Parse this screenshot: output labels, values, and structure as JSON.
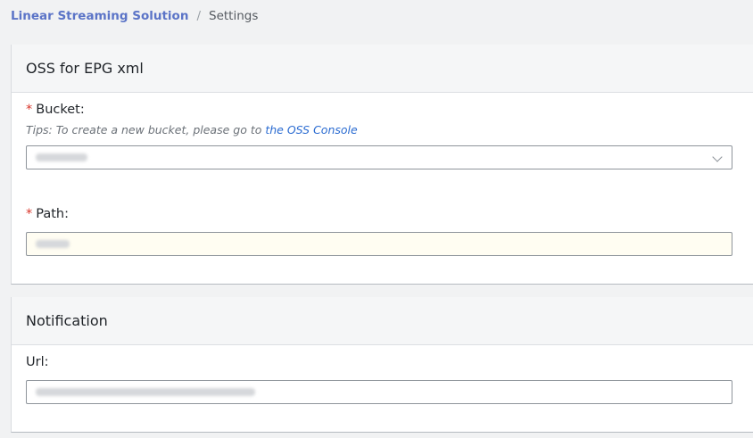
{
  "breadcrumb": {
    "root": "Linear Streaming Solution",
    "separator": "/",
    "current": "Settings"
  },
  "oss_section": {
    "title": "OSS for EPG xml",
    "bucket": {
      "required_mark": "*",
      "label": "Bucket:",
      "tips_prefix": "Tips: To create a new bucket, please go to",
      "tips_link": "the OSS Console",
      "value": "",
      "icon": "chevron-down-icon"
    },
    "path": {
      "required_mark": "*",
      "label": "Path:",
      "value": ""
    }
  },
  "notification_section": {
    "title": "Notification",
    "url": {
      "label": "Url:",
      "value": ""
    }
  },
  "colors": {
    "link": "#5b74c7",
    "tips_link": "#2a6bd1",
    "required": "#d9362b"
  }
}
